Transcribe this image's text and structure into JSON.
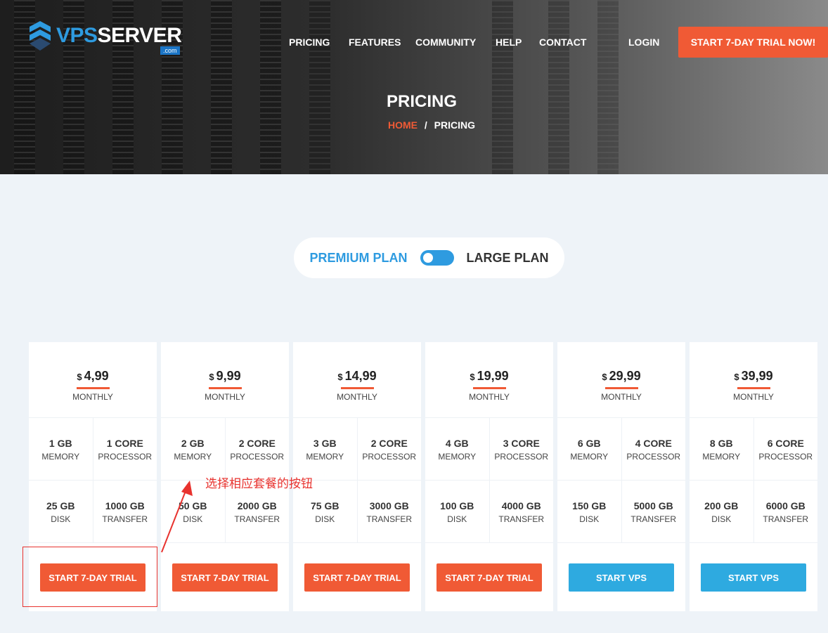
{
  "header": {
    "logo": {
      "part1": "VPS",
      "part2": "SERVER",
      "suffix": ".com"
    },
    "nav": [
      "PRICING",
      "FEATURES",
      "COMMUNITY",
      "HELP",
      "CONTACT"
    ],
    "login": "LOGIN",
    "cta": "START 7-DAY TRIAL NOW!"
  },
  "hero": {
    "title": "PRICING",
    "breadcrumb": {
      "home": "HOME",
      "sep": "/",
      "current": "PRICING"
    }
  },
  "toggle": {
    "left": "PREMIUM PLAN",
    "right": "LARGE PLAN",
    "state": "premium"
  },
  "plans": [
    {
      "currency": "$",
      "price": "4,99",
      "period": "MONTHLY",
      "memory": "1 GB",
      "memory_l": "MEMORY",
      "cpu": "1 CORE",
      "cpu_l": "PROCESSOR",
      "disk": "25 GB",
      "disk_l": "DISK",
      "transfer": "1000 GB",
      "transfer_l": "TRANSFER",
      "button": "START 7-DAY TRIAL",
      "color": "#f05a35"
    },
    {
      "currency": "$",
      "price": "9,99",
      "period": "MONTHLY",
      "memory": "2 GB",
      "memory_l": "MEMORY",
      "cpu": "2 CORE",
      "cpu_l": "PROCESSOR",
      "disk": "50 GB",
      "disk_l": "DISK",
      "transfer": "2000 GB",
      "transfer_l": "TRANSFER",
      "button": "START 7-DAY TRIAL",
      "color": "#f05a35"
    },
    {
      "currency": "$",
      "price": "14,99",
      "period": "MONTHLY",
      "memory": "3 GB",
      "memory_l": "MEMORY",
      "cpu": "2 CORE",
      "cpu_l": "PROCESSOR",
      "disk": "75 GB",
      "disk_l": "DISK",
      "transfer": "3000 GB",
      "transfer_l": "TRANSFER",
      "button": "START 7-DAY TRIAL",
      "color": "#f05a35"
    },
    {
      "currency": "$",
      "price": "19,99",
      "period": "MONTHLY",
      "memory": "4 GB",
      "memory_l": "MEMORY",
      "cpu": "3 CORE",
      "cpu_l": "PROCESSOR",
      "disk": "100 GB",
      "disk_l": "DISK",
      "transfer": "4000 GB",
      "transfer_l": "TRANSFER",
      "button": "START 7-DAY TRIAL",
      "color": "#f05a35"
    },
    {
      "currency": "$",
      "price": "29,99",
      "period": "MONTHLY",
      "memory": "6 GB",
      "memory_l": "MEMORY",
      "cpu": "4 CORE",
      "cpu_l": "PROCESSOR",
      "disk": "150 GB",
      "disk_l": "DISK",
      "transfer": "5000 GB",
      "transfer_l": "TRANSFER",
      "button": "START VPS",
      "color": "#2eaae0"
    },
    {
      "currency": "$",
      "price": "39,99",
      "period": "MONTHLY",
      "memory": "8 GB",
      "memory_l": "MEMORY",
      "cpu": "6 CORE",
      "cpu_l": "PROCESSOR",
      "disk": "200 GB",
      "disk_l": "DISK",
      "transfer": "6000 GB",
      "transfer_l": "TRANSFER",
      "button": "START VPS",
      "color": "#2eaae0"
    }
  ],
  "annotation": "选择相应套餐的按钮"
}
